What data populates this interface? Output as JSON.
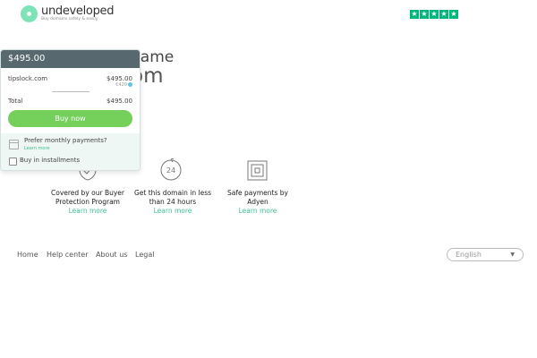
{
  "header": {
    "logo_name": "undeveloped",
    "logo_tagline": "Buy domains safely & easily",
    "rating_stars": 5
  },
  "hero": {
    "title_fragment": "name",
    "domain_fragment": "om",
    "small_fragment": "y"
  },
  "card": {
    "price": "$495.00",
    "domain": "tipslock.com",
    "domain_price": "$495.00",
    "eur_price": "€420",
    "total_label": "Total",
    "total_value": "$495.00",
    "buy_label": "Buy  now",
    "monthly_question": "Prefer monthly payments?",
    "monthly_learn": "Learn more",
    "installments_label": "Buy in installments"
  },
  "features": [
    {
      "line1": "Covered by our Buyer",
      "line2": "Protection Program",
      "link": "Learn more"
    },
    {
      "line1": "Get this domain in less",
      "line2": "than 24 hours",
      "link": "Learn more"
    },
    {
      "line1": "Safe payments by",
      "line2": "Adyen",
      "link": "Learn more"
    }
  ],
  "footer": {
    "links": [
      "Home",
      "Help center",
      "About us",
      "Legal"
    ],
    "language": "English"
  },
  "colors": {
    "accent_green": "#74cf5b",
    "trustpilot_green": "#00b67a",
    "card_header": "#58686f",
    "link_teal": "#3fbf9a"
  }
}
